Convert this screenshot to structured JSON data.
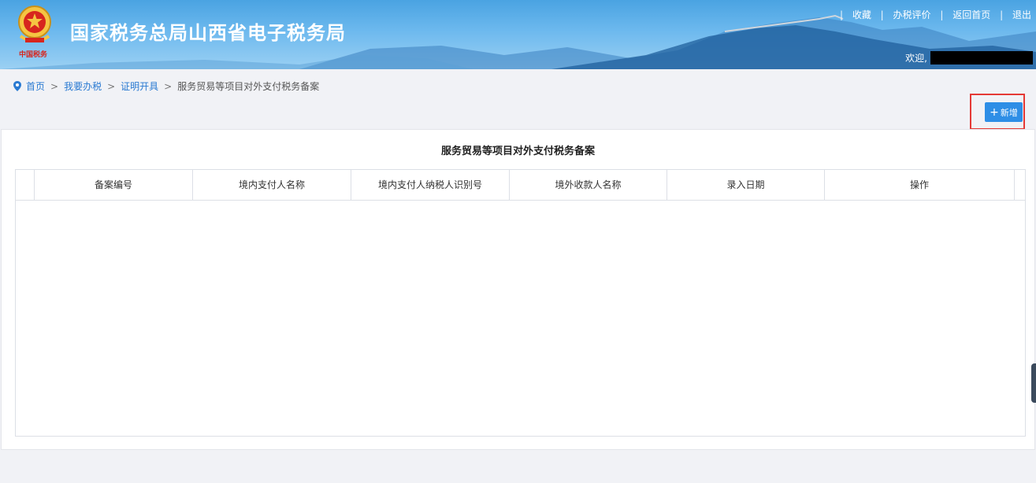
{
  "header": {
    "site_title": "国家税务总局山西省电子税务局",
    "seal_text": "中国税务",
    "links": [
      "收藏",
      "办税评价",
      "返回首页",
      "退出"
    ],
    "welcome_label": "欢迎,"
  },
  "breadcrumb": {
    "items": [
      "首页",
      "我要办税",
      "证明开具"
    ],
    "current": "服务贸易等项目对外支付税务备案"
  },
  "toolbar": {
    "add_label": "新增",
    "add_icon": "plus-icon"
  },
  "table": {
    "title": "服务贸易等项目对外支付税务备案",
    "columns": [
      "备案编号",
      "境内支付人名称",
      "境内支付人纳税人识别号",
      "境外收款人名称",
      "录入日期",
      "操作"
    ],
    "rows": []
  },
  "colors": {
    "accent": "#2e8ee6",
    "highlight_border": "#e53935",
    "header_sky": "#4aa3e2"
  }
}
